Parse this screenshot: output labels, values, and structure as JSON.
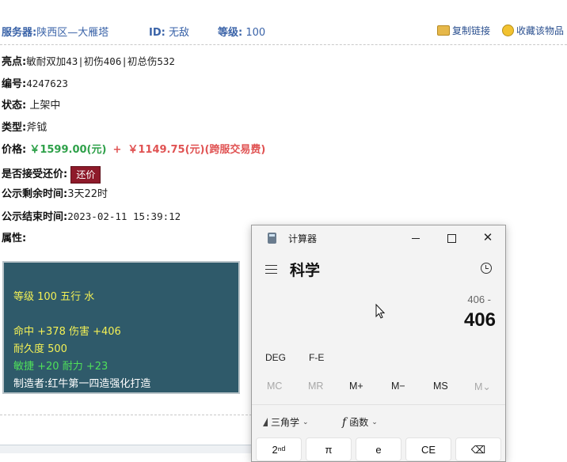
{
  "header": {
    "server_label": "服务器:",
    "server_value": "陕西区—大雁塔",
    "id_label": "ID:",
    "id_value": "无敌",
    "level_label": "等级:",
    "level_value": "100",
    "copy_link": "复制链接",
    "favorite_link": "收藏该物品"
  },
  "item": {
    "highlight_label": "亮点:",
    "highlight_value": "敏耐双加43|初伤406|初总伤532",
    "number_label": "编号:",
    "number_value": "4247623",
    "status_label": "状态:",
    "status_value": "上架中",
    "type_label": "类型:",
    "type_value": "斧钺",
    "price_label": "价格:",
    "price_value": "￥1599.00(元)",
    "price_plus": "+",
    "fee_value": "￥1149.75(元)(跨服交易费)",
    "counter_label": "是否接受还价:",
    "counter_button": "还价",
    "remain_label": "公示剩余时间:",
    "remain_value": "3天22时",
    "end_label": "公示结束时间:",
    "end_value": "2023-02-11 15:39:12",
    "attr_label": "属性:"
  },
  "attributes": {
    "line1": "等级 100 五行 水",
    "line2": "命中 +378 伤害 +406",
    "line3": "耐久度 500",
    "line4": "敏捷 +20 耐力 +23",
    "maker": "制造者:红牛第一四造强化打造"
  },
  "calculator": {
    "window_title": "计算器",
    "mode_title": "科学",
    "expression": "406 -",
    "display": "406",
    "deg": "DEG",
    "fe": "F-E",
    "mem": [
      "MC",
      "MR",
      "M+",
      "M−",
      "MS",
      "M⌄"
    ],
    "trig": "三角学",
    "func": "函数",
    "keys": [
      "2ⁿᵈ",
      "π",
      "e",
      "CE",
      "⌫"
    ]
  },
  "colors": {
    "header_blue": "#3a63a8",
    "price_green": "#2fa14a",
    "price_red": "#e05353",
    "attr_bg": "#2f5a6a",
    "attr_text": "#f3f055",
    "counter_btn": "#8e1a2a"
  }
}
